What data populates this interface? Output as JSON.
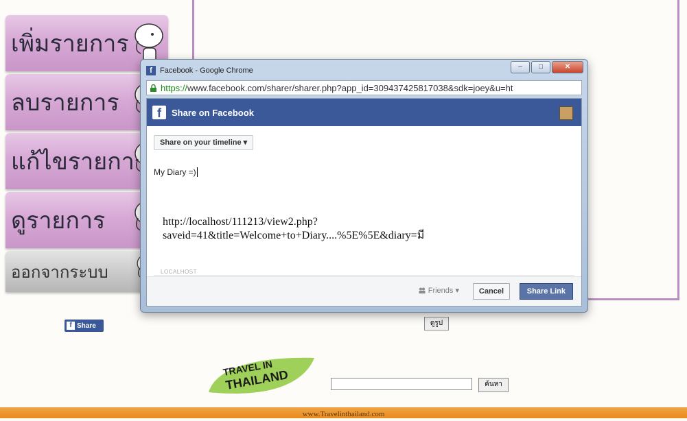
{
  "menu": {
    "items": [
      {
        "label": "เพิ่มรายการ"
      },
      {
        "label": "ลบรายการ"
      },
      {
        "label": "แก้ไขรายการ"
      },
      {
        "label": "ดูรายการ"
      },
      {
        "label": "ออกจากระบบ"
      }
    ]
  },
  "share_button": {
    "label": "Share",
    "icon": "f"
  },
  "view_button": {
    "label": "ดูรูป"
  },
  "popup": {
    "window_title": "Facebook - Google Chrome",
    "url_scheme": "https://",
    "url_rest": "www.facebook.com/sharer/sharer.php?app_id=309437425817038&sdk=joey&u=ht",
    "header_title": "Share on Facebook",
    "timeline_select": "Share on your timeline ▾",
    "message": "My Diary =)",
    "link_line1": "http://localhost/111213/view2.php?",
    "link_line2": "saveid=41&title=Welcome+to+Diary....%5E%5E&diary=มี",
    "link_source": "LOCALHOST",
    "audience": "Friends ▾",
    "cancel_label": "Cancel",
    "share_label": "Share Link"
  },
  "search": {
    "button_label": "ค้นหา",
    "placeholder": ""
  },
  "logo": {
    "line1": "TRAVEL IN",
    "line2": "THAILAND"
  },
  "footer": {
    "url": "www.Travelinthailand.com"
  },
  "colors": {
    "menu_purple": "#d7a9d6",
    "frame_border": "#b98dbf",
    "facebook_blue": "#3b5998",
    "footer_orange": "#e98a1b"
  }
}
